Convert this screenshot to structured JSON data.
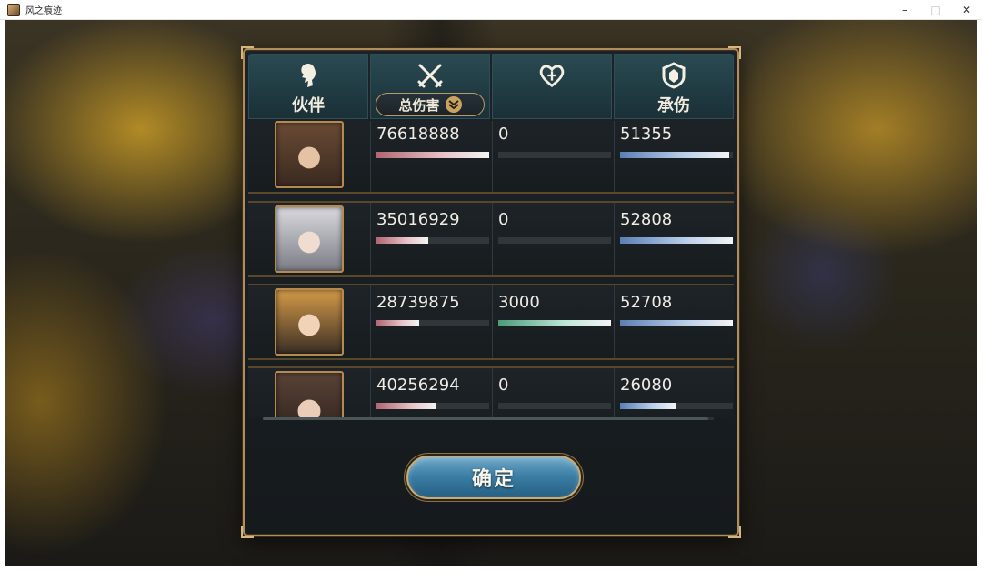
{
  "window": {
    "title": "风之痕迹",
    "minimize": "–",
    "maximize": "□",
    "close": "✕"
  },
  "header": {
    "partner_label": "伙伴",
    "damage_dropdown_label": "总伤害",
    "heal_label": "",
    "taken_label": "承伤"
  },
  "rows": [
    {
      "damage": "76618888",
      "damage_fill": 1.0,
      "heal": "0",
      "heal_fill": 0.0,
      "taken": "51355",
      "taken_fill": 0.97
    },
    {
      "damage": "35016929",
      "damage_fill": 0.46,
      "heal": "0",
      "heal_fill": 0.0,
      "taken": "52808",
      "taken_fill": 1.0
    },
    {
      "damage": "28739875",
      "damage_fill": 0.38,
      "heal": "3000",
      "heal_fill": 1.0,
      "taken": "52708",
      "taken_fill": 1.0
    },
    {
      "damage": "40256294",
      "damage_fill": 0.53,
      "heal": "0",
      "heal_fill": 0.0,
      "taken": "26080",
      "taken_fill": 0.49
    }
  ],
  "confirm_label": "确定",
  "colors": {
    "panel_border": "#b08d5a",
    "tab_bg": "#203a42",
    "damage_bar": "#b06672",
    "heal_bar": "#4c9a7a",
    "taken_bar": "#5b7fb5",
    "button_bg": "#3d7fa6"
  }
}
